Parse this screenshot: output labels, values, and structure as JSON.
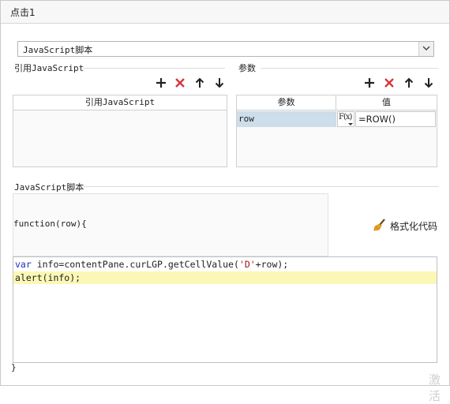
{
  "window": {
    "title": "点击1"
  },
  "script_type_select": {
    "value": "JavaScript脚本"
  },
  "ref_section": {
    "label": "引用JavaScript",
    "column_header": "引用JavaScript"
  },
  "params_section": {
    "label": "参数",
    "columns": [
      "参数",
      "值"
    ],
    "rows": [
      {
        "name": "row",
        "formula_icon": "F(x)",
        "value": "=ROW()"
      }
    ]
  },
  "script_section": {
    "label": "JavaScript脚本",
    "function_signature": "function(row){",
    "format_button": "格式化代码",
    "closing_brace": "}",
    "code_lines": [
      {
        "kw": "var",
        "before_str": " info=contentPane.curLGP.getCellValue(",
        "str": "'D'",
        "after_str": "+row);"
      },
      {
        "plain": "alert(info);"
      }
    ]
  },
  "watermark": "激活",
  "colors": {
    "accent_red": "#d9363e",
    "selected_row": "#cddde9",
    "highlight_line": "#fbf7b5",
    "keyword": "#1f2fbf",
    "string": "#a31515"
  },
  "icons": [
    "add-icon",
    "delete-icon",
    "move-up-icon",
    "move-down-icon",
    "dropdown-arrow-icon",
    "formula-icon",
    "broom-icon"
  ]
}
